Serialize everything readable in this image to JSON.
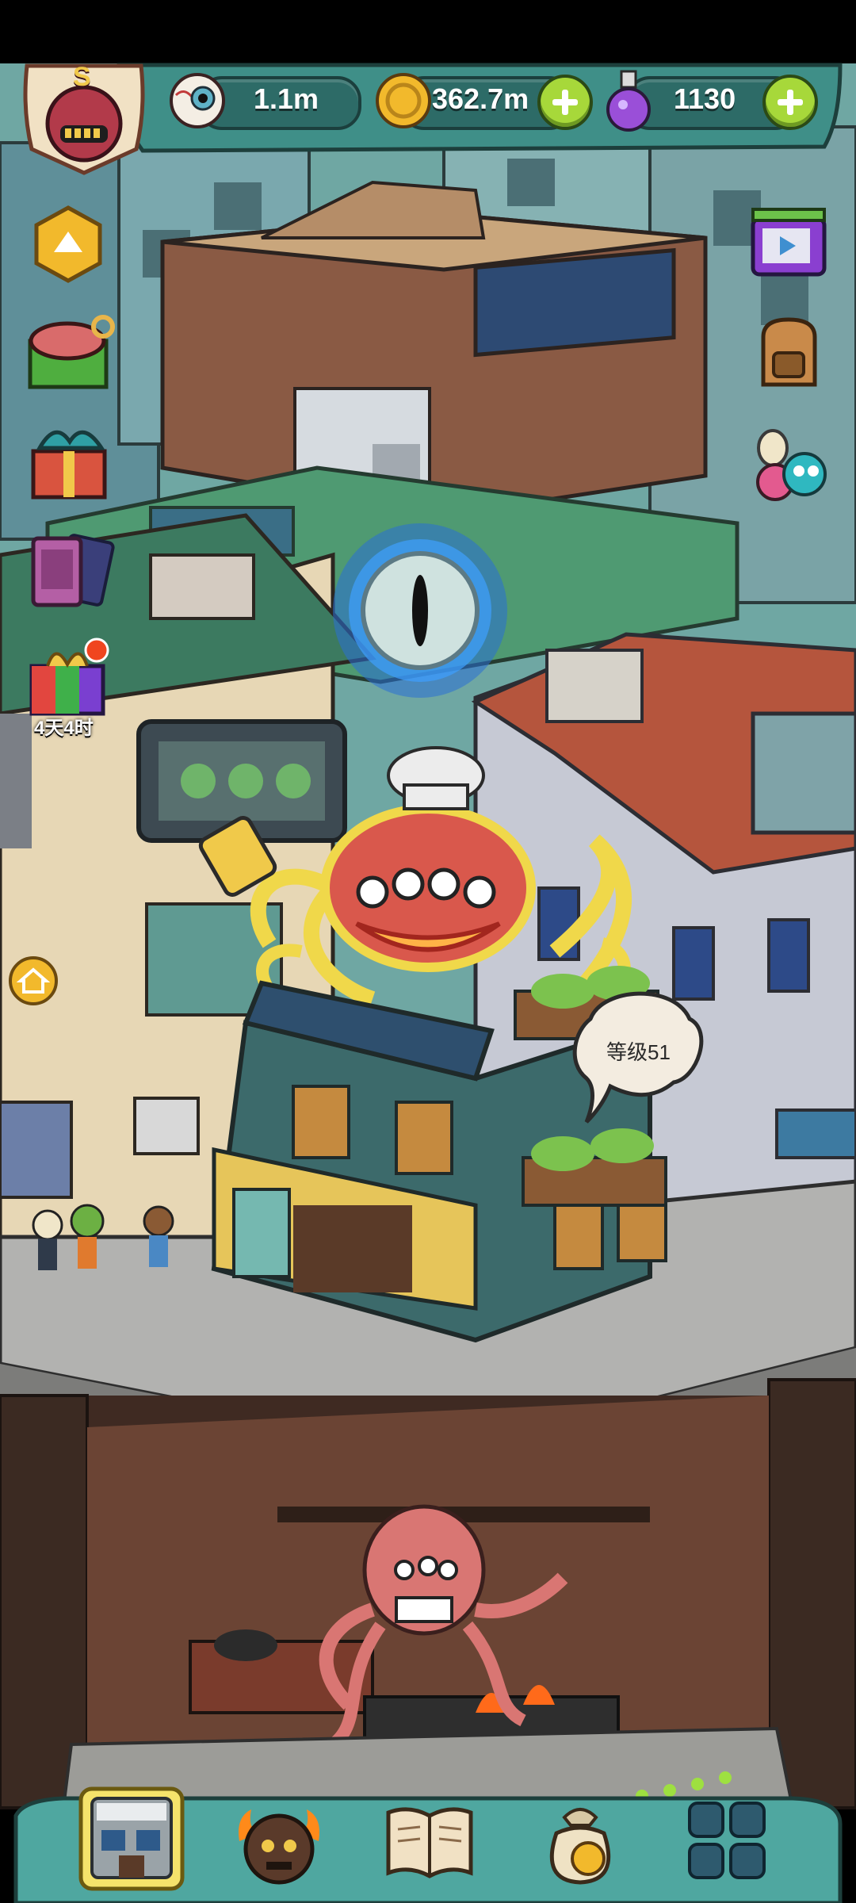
{
  "hud": {
    "level_badge_letter": "S",
    "eyes_value": "1.1m",
    "coins_value": "362.7m",
    "potion_value": "1130"
  },
  "side_left": {
    "gift_timer": "4天4时"
  },
  "building": {
    "level_bubble": "等级51"
  },
  "colors": {
    "hud_bar": "#3f8f88",
    "pill": "#2d6b67",
    "plus": "#a7d83a",
    "bottom_bar": "#4fa7a0"
  }
}
